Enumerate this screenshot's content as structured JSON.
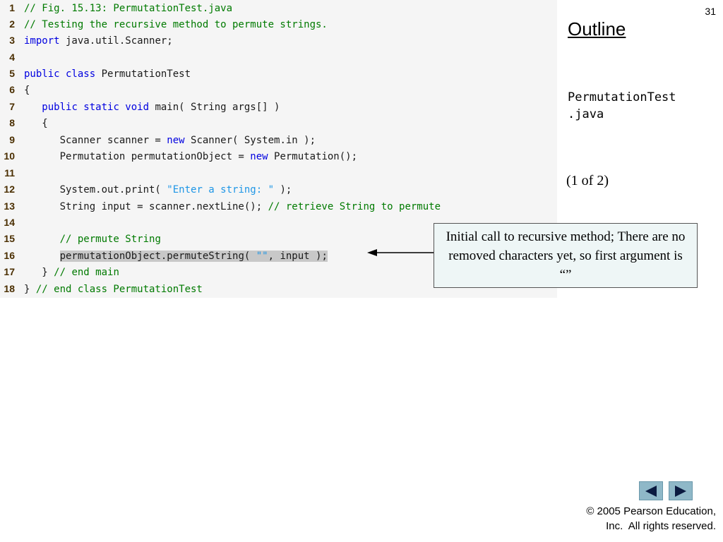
{
  "slide": {
    "number": "31",
    "outline_title": "Outline",
    "file_name": "PermutationTest\n.java",
    "page_indicator": "(1 of 2)",
    "callout_text": "Initial call to recursive method; There are no removed characters yet, so first argument is “”",
    "copyright": "© 2005 Pearson Education,\nInc.  All rights reserved."
  },
  "nav": {
    "prev_icon": "triangle-left-icon",
    "next_icon": "triangle-right-icon"
  },
  "colors": {
    "comment": "#007a00",
    "keyword": "#0000e0",
    "string": "#1e96e6",
    "plain": "#1a1a1a",
    "line_number": "#4a2e00",
    "highlight": "#c8c8c8",
    "callout_bg": "#eef6f6",
    "nav_button": "#8fb8c8"
  },
  "code": {
    "lines": [
      {
        "num": "1",
        "tokens": [
          {
            "t": "comment",
            "s": "// Fig. 15.13: PermutationTest.java"
          }
        ]
      },
      {
        "num": "2",
        "tokens": [
          {
            "t": "comment",
            "s": "// Testing the recursive method to permute strings."
          }
        ]
      },
      {
        "num": "3",
        "tokens": [
          {
            "t": "keyword",
            "s": "import"
          },
          {
            "t": "plain",
            "s": " java.util.Scanner;"
          }
        ]
      },
      {
        "num": "4",
        "tokens": []
      },
      {
        "num": "5",
        "tokens": [
          {
            "t": "keyword",
            "s": "public class"
          },
          {
            "t": "plain",
            "s": " PermutationTest"
          }
        ]
      },
      {
        "num": "6",
        "tokens": [
          {
            "t": "plain",
            "s": "{"
          }
        ]
      },
      {
        "num": "7",
        "tokens": [
          {
            "t": "plain",
            "s": "   "
          },
          {
            "t": "keyword",
            "s": "public static void"
          },
          {
            "t": "plain",
            "s": " main( String args[] )"
          }
        ]
      },
      {
        "num": "8",
        "tokens": [
          {
            "t": "plain",
            "s": "   {"
          }
        ]
      },
      {
        "num": "9",
        "tokens": [
          {
            "t": "plain",
            "s": "      Scanner scanner = "
          },
          {
            "t": "keyword",
            "s": "new"
          },
          {
            "t": "plain",
            "s": " Scanner( System.in );"
          }
        ]
      },
      {
        "num": "10",
        "tokens": [
          {
            "t": "plain",
            "s": "      Permutation permutationObject = "
          },
          {
            "t": "keyword",
            "s": "new"
          },
          {
            "t": "plain",
            "s": " Permutation();"
          }
        ]
      },
      {
        "num": "11",
        "tokens": []
      },
      {
        "num": "12",
        "tokens": [
          {
            "t": "plain",
            "s": "      System.out.print( "
          },
          {
            "t": "string",
            "s": "\"Enter a string: \""
          },
          {
            "t": "plain",
            "s": " );"
          }
        ]
      },
      {
        "num": "13",
        "tokens": [
          {
            "t": "plain",
            "s": "      String input = scanner.nextLine(); "
          },
          {
            "t": "comment",
            "s": "// retrieve String to permute"
          }
        ]
      },
      {
        "num": "14",
        "tokens": []
      },
      {
        "num": "15",
        "tokens": [
          {
            "t": "plain",
            "s": "      "
          },
          {
            "t": "comment",
            "s": "// permute String"
          }
        ]
      },
      {
        "num": "16",
        "tokens": [
          {
            "t": "plain",
            "s": "      "
          },
          {
            "t": "plain",
            "s": "permutationObject.permuteString( ",
            "hl": true
          },
          {
            "t": "string",
            "s": "\"\"",
            "hl": true
          },
          {
            "t": "plain",
            "s": ", input );",
            "hl": true
          }
        ]
      },
      {
        "num": "17",
        "tokens": [
          {
            "t": "plain",
            "s": "   } "
          },
          {
            "t": "comment",
            "s": "// end main"
          }
        ]
      },
      {
        "num": "18",
        "tokens": [
          {
            "t": "plain",
            "s": "} "
          },
          {
            "t": "comment",
            "s": "// end class PermutationTest"
          }
        ]
      }
    ]
  }
}
